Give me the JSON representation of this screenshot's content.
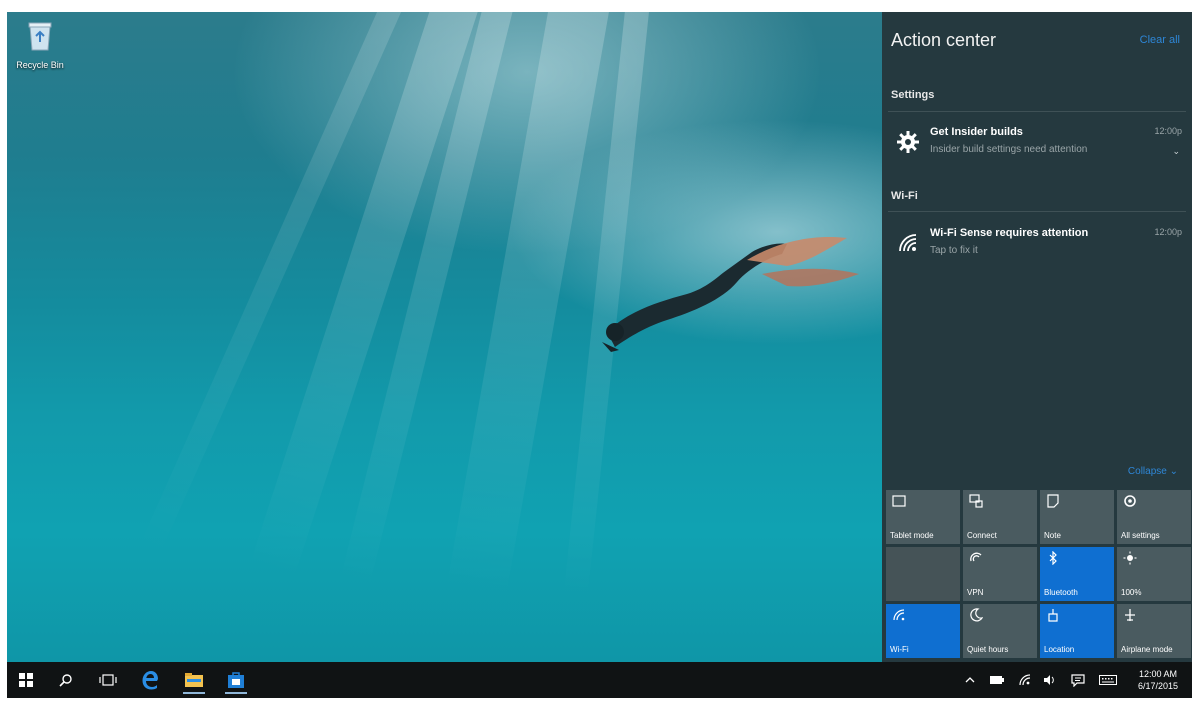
{
  "desktop": {
    "recycle_bin_label": "Recycle Bin"
  },
  "action_center": {
    "title": "Action center",
    "clear_all": "Clear all",
    "groups": [
      {
        "name": "Settings",
        "notifications": [
          {
            "icon": "gear-icon",
            "title": "Get Insider builds",
            "body": "Insider build settings need attention",
            "time": "12:00p"
          }
        ]
      },
      {
        "name": "Wi-Fi",
        "notifications": [
          {
            "icon": "wifi-icon",
            "title": "Wi-Fi Sense requires attention",
            "body": "Tap to fix it",
            "time": "12:00p"
          }
        ]
      }
    ],
    "collapse_label": "Collapse ⌄",
    "quick_actions": [
      {
        "label": "Tablet mode",
        "icon": "tablet-mode-icon",
        "state": "off"
      },
      {
        "label": "Connect",
        "icon": "connect-icon",
        "state": "off"
      },
      {
        "label": "Note",
        "icon": "note-icon",
        "state": "off"
      },
      {
        "label": "All settings",
        "icon": "settings-icon",
        "state": "off"
      },
      {
        "label": "",
        "icon": "",
        "state": "disabled"
      },
      {
        "label": "VPN",
        "icon": "vpn-icon",
        "state": "off"
      },
      {
        "label": "Bluetooth",
        "icon": "bluetooth-icon",
        "state": "on"
      },
      {
        "label": "100%",
        "icon": "brightness-icon",
        "state": "off"
      },
      {
        "label": "Wi-Fi",
        "icon": "wifi-icon",
        "state": "on"
      },
      {
        "label": "Quiet hours",
        "icon": "quiet-hours-icon",
        "state": "off"
      },
      {
        "label": "Location",
        "icon": "location-icon",
        "state": "on"
      },
      {
        "label": "Airplane mode",
        "icon": "airplane-icon",
        "state": "off"
      }
    ]
  },
  "taskbar": {
    "buttons": [
      "start-icon",
      "search-icon",
      "task-view-icon",
      "edge-icon",
      "file-explorer-icon",
      "store-icon"
    ],
    "tray": [
      "chevron-up-icon",
      "battery-icon",
      "network-icon",
      "volume-icon",
      "action-center-icon",
      "keyboard-icon"
    ],
    "clock_time": "12:00 AM",
    "clock_date": "6/17/2015"
  },
  "colors": {
    "accent": "#0f6fd1",
    "action_center_bg": "#25393f",
    "tile_off": "#4a5b60",
    "taskbar_bg": "#101314"
  }
}
